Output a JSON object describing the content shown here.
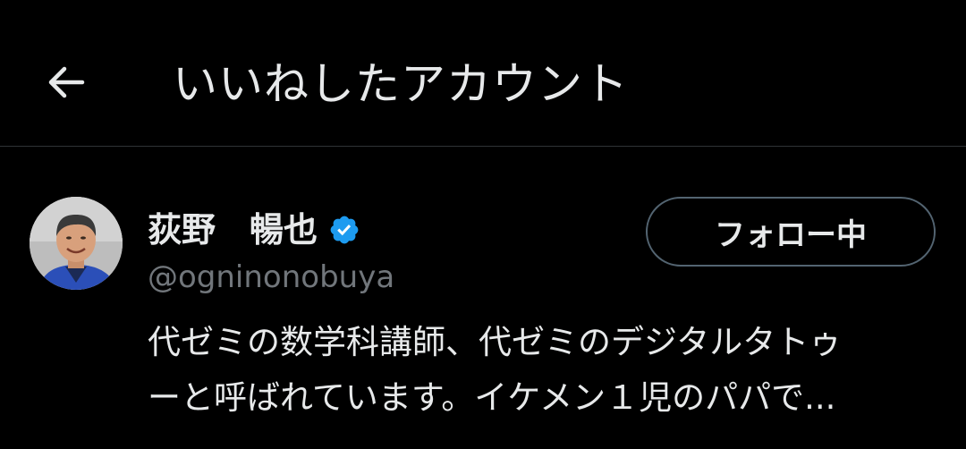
{
  "header": {
    "back_icon": "arrow-left-icon",
    "title": "いいねしたアカウント"
  },
  "user": {
    "display_name": "荻野　暢也",
    "verified_icon": "verified-badge-icon",
    "verified_color": "#1d9bf0",
    "handle": "@ogninonobuya",
    "follow_label": "フォロー中",
    "bio_line1": "代ゼミの数学科講師、代ゼミのデジタルタトゥ",
    "bio_line2": "ーと呼ばれています。イケメン１児のパパで..."
  }
}
